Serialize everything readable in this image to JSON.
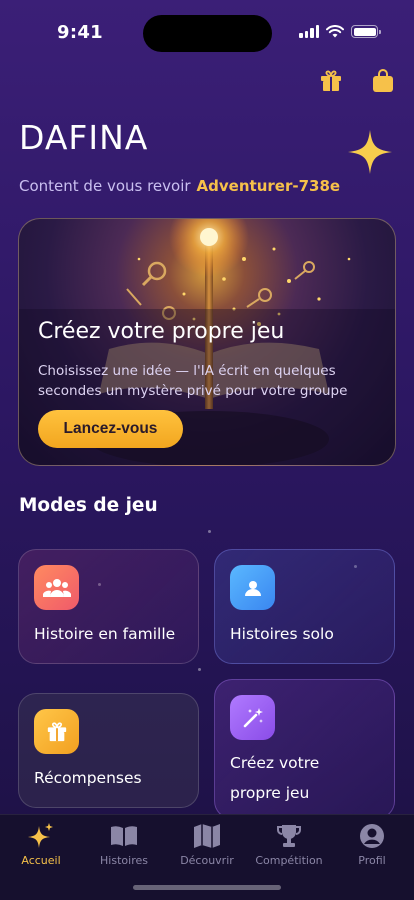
{
  "status_bar": {
    "time": "9:41"
  },
  "header": {
    "brand": "DAFINA",
    "greeting": "Content de vous revoir",
    "username": "Adventurer-738e"
  },
  "hero": {
    "title": "Créez votre propre jeu",
    "description": "Choisissez une idée — l'IA écrit en quelques secondes un mystère privé pour votre groupe",
    "cta_label": "Lancez-vous"
  },
  "modes": {
    "section_title": "Modes de jeu",
    "items": [
      {
        "label": "Histoire en famille",
        "icon": "family-icon",
        "color": "#ff7a5a"
      },
      {
        "label": "Histoires solo",
        "icon": "person-icon",
        "color": "#4aa6f5"
      },
      {
        "label": "Récompenses",
        "icon": "gift-icon",
        "color": "#f6b23a"
      },
      {
        "label_line1": "Créez votre",
        "label_line2": "propre jeu",
        "icon": "magic-wand-icon",
        "color": "#9a5cf0"
      }
    ]
  },
  "tabbar": {
    "items": [
      {
        "label": "Accueil",
        "icon": "sparkle-icon",
        "active": true
      },
      {
        "label": "Histoires",
        "icon": "book-icon"
      },
      {
        "label": "Découvrir",
        "icon": "map-icon"
      },
      {
        "label": "Compétition",
        "icon": "trophy-icon"
      },
      {
        "label": "Profil",
        "icon": "profile-icon"
      }
    ]
  },
  "colors": {
    "accent": "#f6c14a",
    "background": "#2c1762"
  }
}
